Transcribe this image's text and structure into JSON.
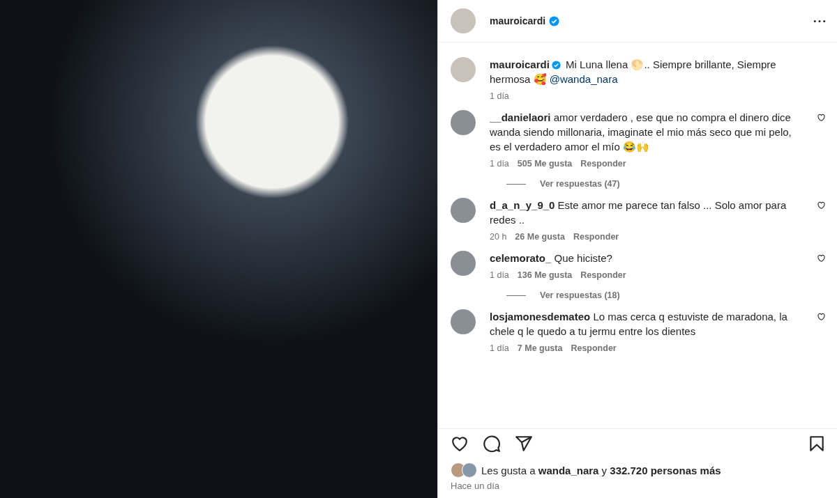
{
  "post": {
    "author": "mauroicardi",
    "verified": true
  },
  "caption": {
    "username": "mauroicardi",
    "verified": true,
    "text": "Mi Luna llena 🌕.. Siempre brillante, Siempre hermosa 🥰",
    "mention": "@wanda_nara",
    "time": "1 día"
  },
  "comments": [
    {
      "username": "__danielaori",
      "text": "amor verdadero , ese que no compra el dinero dice wanda siendo millonaria, imaginate el mio más seco que mi pelo, es el verdadero amor el mío 😂🙌",
      "time": "1 día",
      "likes": "505 Me gusta",
      "reply": "Responder",
      "replies": "Ver respuestas (47)"
    },
    {
      "username": "d_a_n_y_9_0",
      "text": "Este amor me parece tan falso ... Solo amor para redes ..",
      "time": "20 h",
      "likes": "26 Me gusta",
      "reply": "Responder"
    },
    {
      "username": "celemorato_",
      "text": "Que hiciste?",
      "time": "1 día",
      "likes": "136 Me gusta",
      "reply": "Responder",
      "replies": "Ver respuestas (18)"
    },
    {
      "username": "losjamonesdemateo",
      "text": "Lo mas cerca q estuviste de maradona, la chele q le quedo a tu jermu entre los dientes",
      "time": "1 día",
      "likes": "7 Me gusta",
      "reply": "Responder"
    }
  ],
  "likes_text": "Les gusta a **wanda_nara** y **332.720 personas más**",
  "posted": "Hace un día"
}
